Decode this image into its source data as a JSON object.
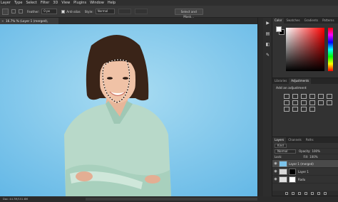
{
  "menubar": {
    "items": [
      "Layer",
      "Type",
      "Select",
      "Filter",
      "3D",
      "View",
      "Plugins",
      "Window",
      "Help"
    ]
  },
  "options": {
    "feather_label": "Feather:",
    "feather_value": "0 px",
    "antialias_label": "Anti-alias",
    "style_label": "Style:",
    "style_value": "Normal",
    "select_mask_label": "Select and Mask..."
  },
  "document": {
    "tab_title": "% (Layer 1 (merged), RGB/8)",
    "zoom": "16.7%"
  },
  "status": {
    "text": "Doc: 44.7M/151.6M"
  },
  "color_panel": {
    "tabs": [
      "Color",
      "Swatches",
      "Gradients",
      "Patterns"
    ],
    "fg_color": "#ffffff",
    "bg_color": "#000000"
  },
  "adjust_panel": {
    "tabs": [
      "Libraries",
      "Adjustments"
    ],
    "title": "Add an adjustment"
  },
  "layers_panel": {
    "tabs": [
      "Layers",
      "Channels",
      "Paths"
    ],
    "filter_label": "Kind",
    "blend_mode": "Normal",
    "opacity_label": "Opacity:",
    "opacity_value": "100%",
    "lock_label": "Lock:",
    "fill_label": "Fill:",
    "fill_value": "100%",
    "layers": [
      {
        "name": "Layer 1 (merged)",
        "selected": true
      },
      {
        "name": "Layer 1",
        "selected": false
      },
      {
        "name": "Radu",
        "selected": false
      }
    ]
  }
}
